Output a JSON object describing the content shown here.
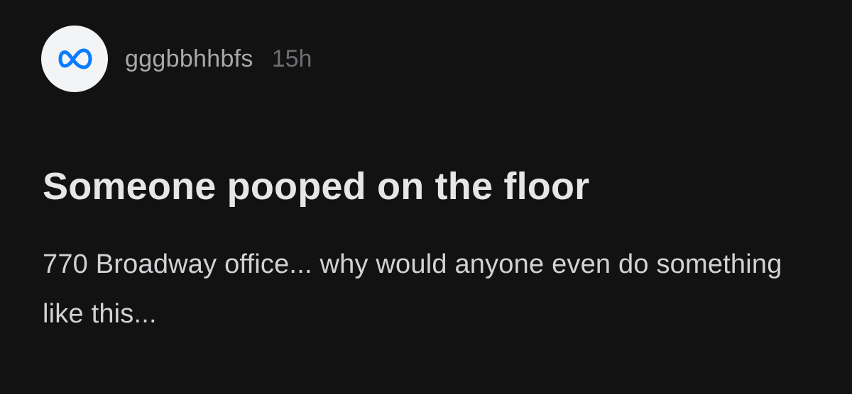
{
  "post": {
    "author": {
      "avatar_icon": "meta-logo-icon",
      "username": "gggbbhhbfs",
      "timestamp": "15h"
    },
    "title": "Someone pooped on the floor",
    "body": "770 Broadway office... why would anyone even do something like this..."
  },
  "colors": {
    "background": "#121212",
    "avatar_bg": "#f3f4f6",
    "meta_blue": "#0a7cff",
    "title": "#e6e6e8",
    "body": "#d2d2d6",
    "username": "#a9a9ad",
    "timestamp": "#6e6e73"
  }
}
